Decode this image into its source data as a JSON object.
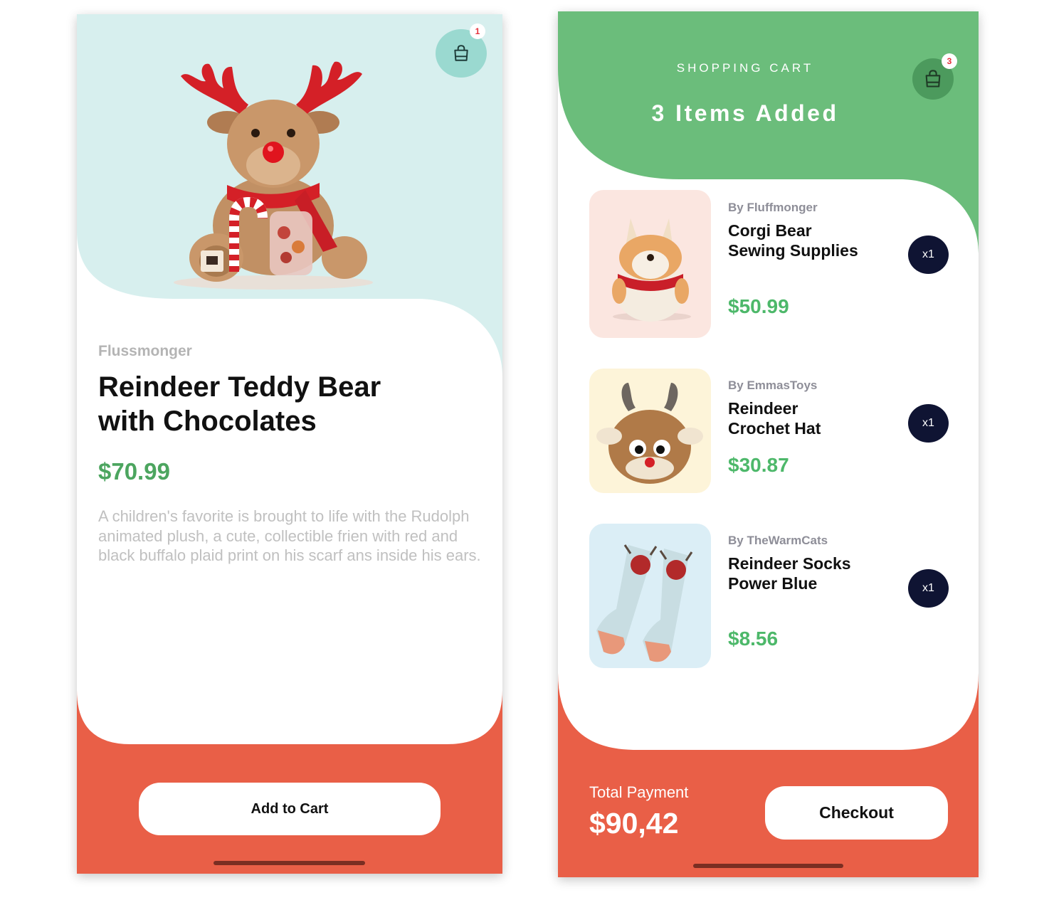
{
  "product": {
    "seller": "Flussmonger",
    "title_line1": "Reindeer Teddy Bear",
    "title_line2": "with Chocolates",
    "price": "$70.99",
    "description": "A children's favorite is brought to life with the Rudolph animated plush, a cute, collectible frien with red and black buffalo plaid print on his scarf ans inside his ears.",
    "cart_badge": "1",
    "add_to_cart_label": "Add to Cart",
    "image_icon": "reindeer-teddy-image"
  },
  "cart": {
    "header_label": "SHOPPING CART",
    "items_added": "3 Items Added",
    "cart_badge": "3",
    "items": [
      {
        "seller": "By Fluffmonger",
        "name": "Corgi Bear Sewing Supplies",
        "price": "$50.99",
        "qty": "x1",
        "image_icon": "corgi-plush-image"
      },
      {
        "seller": "By EmmasToys",
        "name": "Reindeer Crochet Hat",
        "price": "$30.87",
        "qty": "x1",
        "image_icon": "crochet-hat-image"
      },
      {
        "seller": "By TheWarmCats",
        "name": "Reindeer Socks Power Blue",
        "price": "$8.56",
        "qty": "x1",
        "image_icon": "socks-image"
      }
    ],
    "total_label": "Total Payment",
    "total_value": "$90,42",
    "checkout_label": "Checkout"
  },
  "colors": {
    "accent_green": "#4db86a",
    "header_green": "#6bbd7b",
    "footer_coral": "#e95f47",
    "mint_bg": "#d7efee",
    "navy_badge": "#0f1433"
  }
}
